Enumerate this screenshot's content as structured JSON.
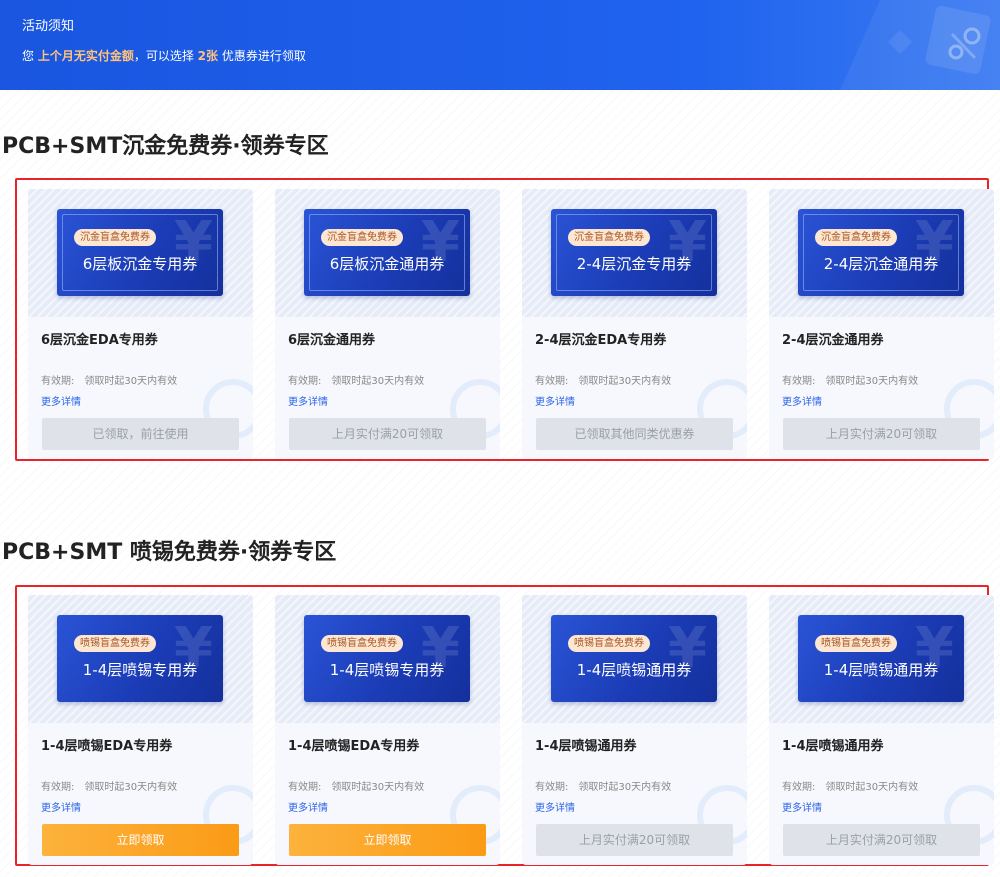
{
  "notice": {
    "title": "活动须知",
    "text_prefix": "您 ",
    "highlight": "上个月无实付金额",
    "text_middle": "，可以选择 ",
    "count": "2张",
    "text_suffix": " 优惠券进行领取"
  },
  "sections": [
    {
      "title": "PCB+SMT沉金免费券·领券专区",
      "cards": [
        {
          "tag": "沉金盲盒免费券",
          "ticket_name": "6层板沉金专用券",
          "name": "6层沉金EDA专用券",
          "validity_label": "有效期:",
          "validity": "领取时起30天内有效",
          "more": "更多详情",
          "button": "已领取，前往使用",
          "button_state": "disabled"
        },
        {
          "tag": "沉金盲盒免费券",
          "ticket_name": "6层板沉金通用券",
          "name": "6层沉金通用券",
          "validity_label": "有效期:",
          "validity": "领取时起30天内有效",
          "more": "更多详情",
          "button": "上月实付满20可领取",
          "button_state": "disabled"
        },
        {
          "tag": "沉金盲盒免费券",
          "ticket_name": "2-4层沉金专用券",
          "name": "2-4层沉金EDA专用券",
          "validity_label": "有效期:",
          "validity": "领取时起30天内有效",
          "more": "更多详情",
          "button": "已领取其他同类优惠券",
          "button_state": "disabled"
        },
        {
          "tag": "沉金盲盒免费券",
          "ticket_name": "2-4层沉金通用券",
          "name": "2-4层沉金通用券",
          "validity_label": "有效期:",
          "validity": "领取时起30天内有效",
          "more": "更多详情",
          "button": "上月实付满20可领取",
          "button_state": "disabled"
        }
      ]
    },
    {
      "title": "PCB+SMT 喷锡免费券·领券专区",
      "cards": [
        {
          "tag": "喷锡盲盒免费券",
          "ticket_name": "1-4层喷锡专用券",
          "name": "1-4层喷锡EDA专用券",
          "validity_label": "有效期:",
          "validity": "领取时起30天内有效",
          "more": "更多详情",
          "button": "立即领取",
          "button_state": "active"
        },
        {
          "tag": "喷锡盲盒免费券",
          "ticket_name": "1-4层喷锡专用券",
          "name": "1-4层喷锡EDA专用券",
          "validity_label": "有效期:",
          "validity": "领取时起30天内有效",
          "more": "更多详情",
          "button": "立即领取",
          "button_state": "active"
        },
        {
          "tag": "喷锡盲盒免费券",
          "ticket_name": "1-4层喷锡通用券",
          "name": "1-4层喷锡通用券",
          "validity_label": "有效期:",
          "validity": "领取时起30天内有效",
          "more": "更多详情",
          "button": "上月实付满20可领取",
          "button_state": "disabled"
        },
        {
          "tag": "喷锡盲盒免费券",
          "ticket_name": "1-4层喷锡通用券",
          "name": "1-4层喷锡通用券",
          "validity_label": "有效期:",
          "validity": "领取时起30天内有效",
          "more": "更多详情",
          "button": "上月实付满20可领取",
          "button_state": "disabled"
        }
      ]
    }
  ],
  "colors": {
    "banner": "#1a56e0",
    "highlight": "#ffc27a",
    "section_border": "#e8242a",
    "link": "#2b63e8",
    "button_active": "#fb9b16",
    "button_disabled": "#dfe2e8"
  },
  "ticket_icon": "yen-sign"
}
